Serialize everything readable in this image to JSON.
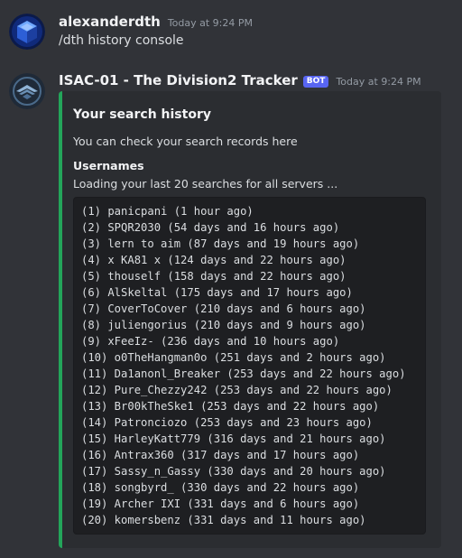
{
  "message1": {
    "username": "alexanderdth",
    "timestamp": "Today at 9:24 PM",
    "text": "/dth history console",
    "avatar_icon": "cube-icon"
  },
  "message2": {
    "username": "ISAC-01 - The Division2 Tracker",
    "bot_badge": "BOT",
    "timestamp": "Today at 9:24 PM",
    "avatar_icon": "division-shd-icon",
    "embed": {
      "accent_color": "#23a55a",
      "title": "Your search history",
      "description": "You can check your search records here",
      "field_name": "Usernames",
      "field_value": "Loading your last 20 searches for all servers ...",
      "lines": [
        "(1) panicpani (1 hour ago)",
        "(2) SPQR2030 (54 days and 16 hours ago)",
        "(3) lern to aim (87 days and 19 hours ago)",
        "(4) x KA81 x (124 days and 22 hours ago)",
        "(5) thouself (158 days and 22 hours ago)",
        "(6) AlSkeltal (175 days and 17 hours ago)",
        "(7) CoverToCover (210 days and 6 hours ago)",
        "(8) juliengorius (210 days and 9 hours ago)",
        "(9) xFeeIz- (236 days and 10 hours ago)",
        "(10) o0TheHangman0o (251 days and 2 hours ago)",
        "(11) Da1anonl_Breaker (253 days and 22 hours ago)",
        "(12) Pure_Chezzy242 (253 days and 22 hours ago)",
        "(13) Br00kTheSke1 (253 days and 22 hours ago)",
        "(14) Patronciozo (253 days and 23 hours ago)",
        "(15) HarleyKatt779 (316 days and 21 hours ago)",
        "(16) Antrax360 (317 days and 17 hours ago)",
        "(17) Sassy_n_Gassy (330 days and 20 hours ago)",
        "(18) songbyrd_ (330 days and 22 hours ago)",
        "(19) Archer IXI (331 days and 6 hours ago)",
        "(20) komersbenz (331 days and 11 hours ago)"
      ]
    }
  }
}
